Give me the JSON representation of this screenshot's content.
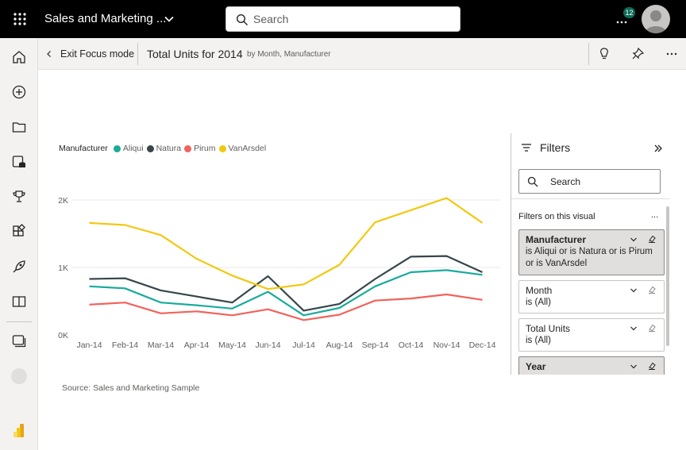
{
  "topbar": {
    "app_title": "Sales and Marketing ...",
    "search_placeholder": "Search",
    "notification_count": "12"
  },
  "header": {
    "exit_focus_label": "Exit Focus mode",
    "visual_title": "Total Units for 2014",
    "visual_subtitle": "by Month, Manufacturer"
  },
  "nav": {
    "items": [
      "home-icon",
      "create-icon",
      "browse-icon",
      "datahub-icon",
      "goals-icon",
      "apps-icon",
      "deployment-icon",
      "learn-icon",
      "workspaces-icon",
      "workspace-avatar",
      "powerbi-logo"
    ]
  },
  "legend": {
    "title": "Manufacturer",
    "items": [
      {
        "label": "Aliqui",
        "color": "#1aab9b"
      },
      {
        "label": "Natura",
        "color": "#374649"
      },
      {
        "label": "Pirum",
        "color": "#f2625b"
      },
      {
        "label": "VanArsdel",
        "color": "#f2c80f"
      }
    ]
  },
  "chart_data": {
    "type": "line",
    "x": [
      "Jan-14",
      "Feb-14",
      "Mar-14",
      "Apr-14",
      "May-14",
      "Jun-14",
      "Jul-14",
      "Aug-14",
      "Sep-14",
      "Oct-14",
      "Nov-14",
      "Dec-14"
    ],
    "y_ticks": [
      "2K",
      "1K",
      "0K"
    ],
    "ylim": [
      0,
      2000
    ],
    "grid": true,
    "legend_position": "top-left",
    "series": [
      {
        "name": "Aliqui",
        "color": "#1aab9b",
        "values": [
          720,
          690,
          480,
          440,
          390,
          640,
          290,
          400,
          720,
          930,
          960,
          890
        ]
      },
      {
        "name": "Natura",
        "color": "#374649",
        "values": [
          830,
          840,
          660,
          570,
          480,
          870,
          360,
          460,
          830,
          1160,
          1170,
          930
        ]
      },
      {
        "name": "Pirum",
        "color": "#f2625b",
        "values": [
          450,
          480,
          320,
          350,
          290,
          380,
          220,
          300,
          510,
          540,
          600,
          520
        ]
      },
      {
        "name": "VanArsdel",
        "color": "#f2c80f",
        "values": [
          1660,
          1630,
          1480,
          1130,
          880,
          680,
          750,
          1040,
          1670,
          1850,
          2030,
          1660
        ]
      }
    ]
  },
  "source": "Source: Sales and Marketing Sample",
  "filters": {
    "title": "Filters",
    "search_placeholder": "Search",
    "section_label": "Filters on this visual",
    "section_more": "...",
    "cards": [
      {
        "name": "Manufacturer",
        "desc": "is Aliqui or is Natura or is Pirum or is VanArsdel"
      },
      {
        "name": "Month",
        "desc": "is (All)"
      },
      {
        "name": "Total Units",
        "desc": "is (All)"
      },
      {
        "name": "Year",
        "desc": ""
      }
    ]
  },
  "colors": {
    "topbar": "#000000",
    "accent": "#f2c80f"
  }
}
